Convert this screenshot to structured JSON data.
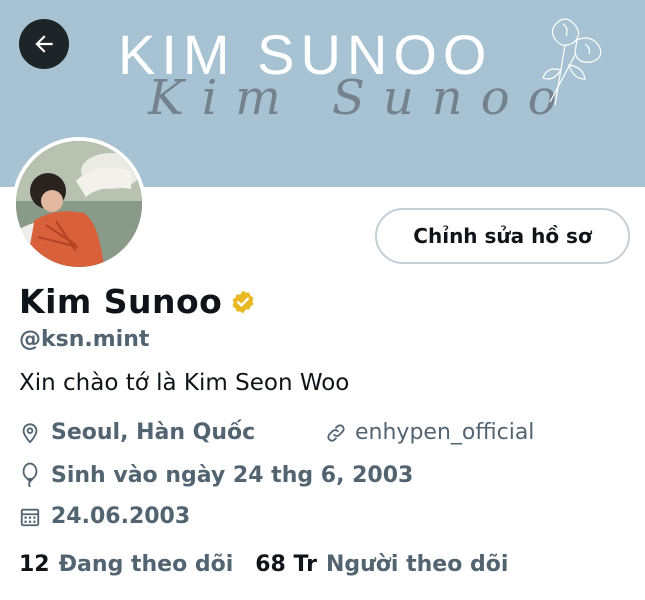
{
  "header": {
    "banner_title": "KIM SUNOO",
    "banner_script": "Kim Sunoo",
    "back_icon": "arrow-left-icon"
  },
  "profile": {
    "edit_label": "Chỉnh sửa hồ sơ",
    "display_name": "Kim Sunoo",
    "handle": "@ksn.mint",
    "bio": "Xin chào tớ là Kim Seon Woo",
    "location": "Seoul, Hàn Quốc",
    "website": "enhypen_official",
    "birthday": "Sinh vào ngày 24 thg 6, 2003",
    "joined": "24.06.2003",
    "following_count": "12",
    "following_label": "Đang theo dõi",
    "followers_count": "68 Tr",
    "followers_label": "Người theo dõi"
  },
  "colors": {
    "banner": "#a7c2d2",
    "secondary_text": "#536471",
    "verified_badge": "#e8b923"
  }
}
